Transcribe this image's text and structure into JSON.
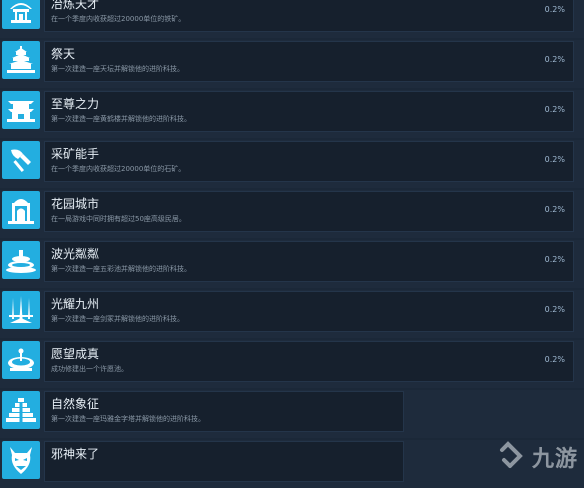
{
  "achievements": [
    {
      "title": "冶炼天才",
      "desc": "在一个季度内收获超过20000单位的铁矿。",
      "pct": "0.2%",
      "icon": "shrine-icon"
    },
    {
      "title": "祭天",
      "desc": "第一次建造一座天坛并解锁他的进阶科技。",
      "pct": "0.2%",
      "icon": "temple-of-heaven-icon"
    },
    {
      "title": "至尊之力",
      "desc": "第一次建造一座黄鹤楼并解锁他的进阶科技。",
      "pct": "0.2%",
      "icon": "pagoda-icon"
    },
    {
      "title": "采矿能手",
      "desc": "在一个季度内收获超过20000单位的石矿。",
      "pct": "0.2%",
      "icon": "axe-icon"
    },
    {
      "title": "花园城市",
      "desc": "在一局游戏中同时拥有超过50座高级民居。",
      "pct": "0.2%",
      "icon": "gate-icon"
    },
    {
      "title": "波光粼粼",
      "desc": "第一次建造一座五彩池并解锁他的进阶科技。",
      "pct": "0.2%",
      "icon": "pool-icon"
    },
    {
      "title": "光耀九州",
      "desc": "第一次建造一座剑冢并解锁他的进阶科技。",
      "pct": "0.2%",
      "icon": "swords-icon"
    },
    {
      "title": "愿望成真",
      "desc": "成功修建出一个许愿池。",
      "pct": "0.2%",
      "icon": "fountain-icon"
    },
    {
      "title": "自然象征",
      "desc": "第一次建造一座玛雅金字塔并解锁他的进阶科技。",
      "pct": "",
      "icon": "pyramid-icon"
    },
    {
      "title": "邪神来了",
      "desc": "",
      "pct": "",
      "icon": "demon-mask-icon"
    }
  ],
  "watermark": {
    "text": "九游"
  }
}
